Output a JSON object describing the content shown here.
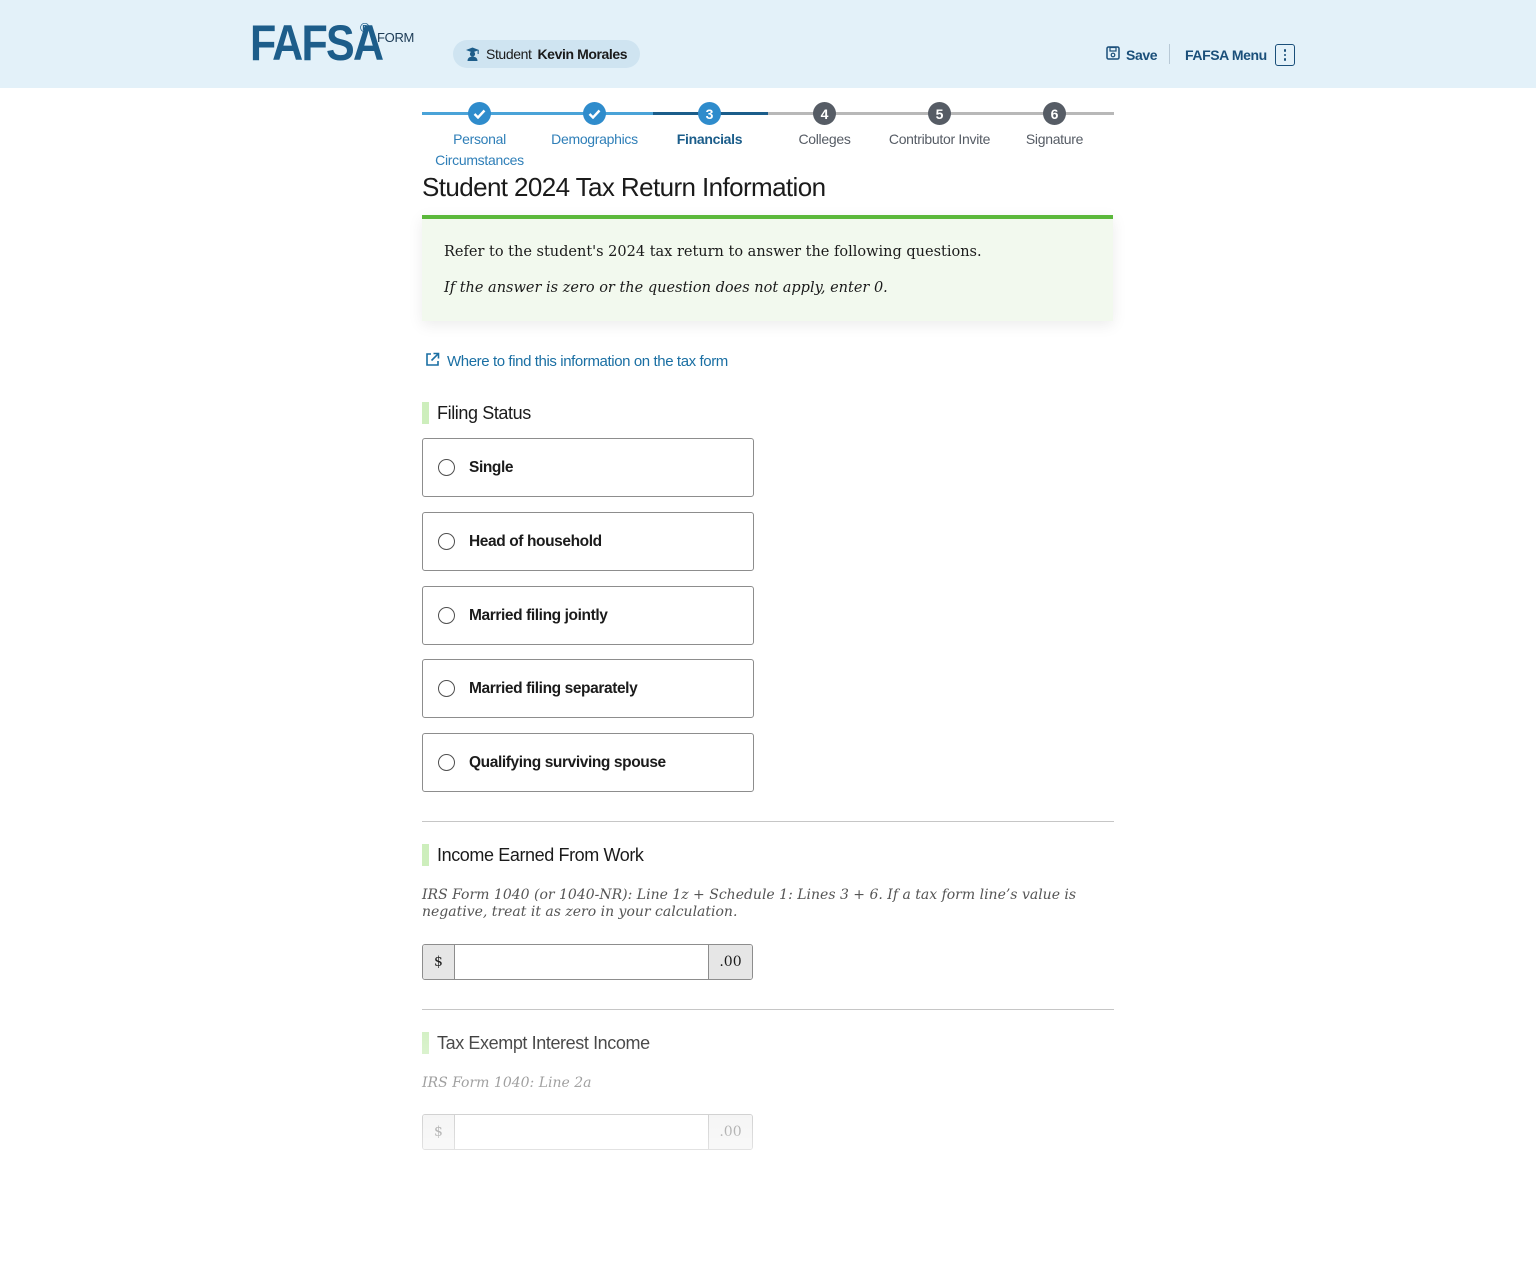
{
  "header": {
    "logo_text": "FAFSA",
    "logo_reg": "®",
    "logo_form": "FORM",
    "student_label": "Student",
    "student_name": "Kevin Morales",
    "save_label": "Save",
    "menu_label": "FAFSA Menu"
  },
  "stepper": {
    "steps": [
      {
        "number": "1",
        "label": "Personal Circumstances",
        "state": "complete"
      },
      {
        "number": "2",
        "label": "Demographics",
        "state": "complete"
      },
      {
        "number": "3",
        "label": "Financials",
        "state": "current"
      },
      {
        "number": "4",
        "label": "Colleges",
        "state": "upcoming"
      },
      {
        "number": "5",
        "label": "Contributor Invite",
        "state": "upcoming"
      },
      {
        "number": "6",
        "label": "Signature",
        "state": "upcoming"
      }
    ]
  },
  "page": {
    "title": "Student 2024 Tax Return Information",
    "info_line1": "Refer to the student's 2024 tax return to answer the following questions.",
    "info_line2": "If the answer is zero or the question does not apply, enter 0.",
    "find_link": "Where to find this information on the tax form"
  },
  "filing_status": {
    "title": "Filing Status",
    "options": [
      "Single",
      "Head of household",
      "Married filing jointly",
      "Married filing separately",
      "Qualifying surviving spouse"
    ]
  },
  "income_work": {
    "title": "Income Earned From Work",
    "help": "IRS Form 1040 (or 1040-NR): Line 1z + Schedule 1: Lines 3 + 6. If a tax form line’s value is negative, treat it as zero in your calculation.",
    "prefix": "$",
    "suffix": ".00",
    "value": ""
  },
  "tax_exempt": {
    "title": "Tax Exempt Interest Income",
    "help": "IRS Form 1040: Line 2a",
    "prefix": "$",
    "suffix": ".00",
    "value": ""
  },
  "colors": {
    "header_bg": "#e3f1f9",
    "brand_blue": "#1d5d8a",
    "complete_blue": "#2f8ccc",
    "current_blue": "#1b5d8a",
    "upcoming_gray": "#565c65",
    "accent_green": "#5bb83b"
  }
}
